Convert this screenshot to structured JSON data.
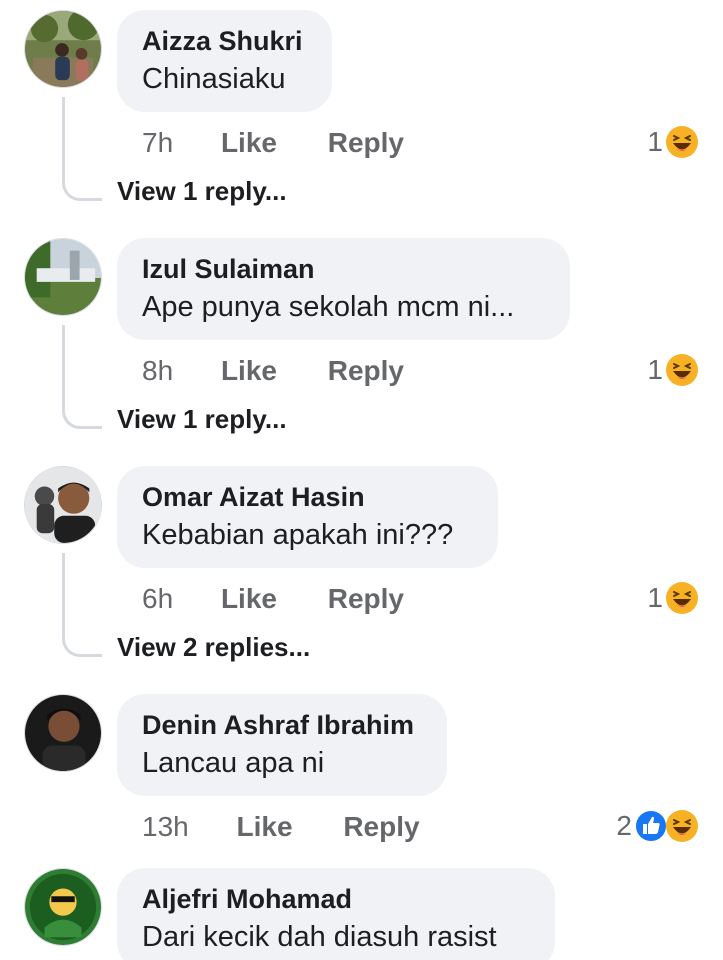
{
  "comments": [
    {
      "author": "Aizza Shukri",
      "text": "Chinasiaku",
      "time": "7h",
      "like_label": "Like",
      "reply_label": "Reply",
      "reaction_count": "1",
      "reactions": [
        "haha-icon"
      ],
      "view_replies": "View 1 reply..."
    },
    {
      "author": "Izul Sulaiman",
      "text": "Ape punya sekolah mcm ni...",
      "time": "8h",
      "like_label": "Like",
      "reply_label": "Reply",
      "reaction_count": "1",
      "reactions": [
        "haha-icon"
      ],
      "view_replies": "View 1 reply..."
    },
    {
      "author": "Omar Aizat Hasin",
      "text": "Kebabian apakah ini???",
      "time": "6h",
      "like_label": "Like",
      "reply_label": "Reply",
      "reaction_count": "1",
      "reactions": [
        "haha-icon"
      ],
      "view_replies": "View 2 replies..."
    },
    {
      "author": "Denin Ashraf Ibrahim",
      "text": "Lancau apa ni",
      "time": "13h",
      "like_label": "Like",
      "reply_label": "Reply",
      "reaction_count": "2",
      "reactions": [
        "like-icon",
        "haha-icon"
      ]
    },
    {
      "author": "Aljefri Mohamad",
      "text": "Dari kecik dah diasuh rasist"
    }
  ],
  "colors": {
    "bubble": "#f0f2f5",
    "name": "#1c1e21",
    "meta": "#65676b",
    "haha": "#f7b125",
    "like": "#1877f2"
  }
}
